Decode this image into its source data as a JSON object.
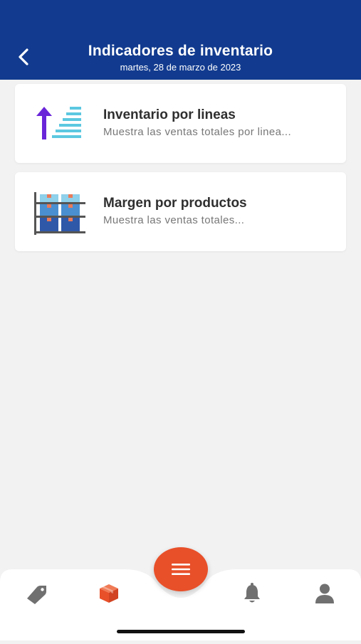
{
  "header": {
    "title": "Indicadores de inventario",
    "date": "martes, 28 de marzo de 2023",
    "background_color": "#123b8f",
    "back_icon": "chevron-left-icon"
  },
  "cards": [
    {
      "title": "Inventario por lineas",
      "description": "Muestra las ventas totales por linea...",
      "icon": "inventory-lines-icon"
    },
    {
      "title": "Margen por productos",
      "description": "Muestra las ventas totales...",
      "icon": "product-shelf-icon"
    }
  ],
  "bottom_nav": {
    "items": [
      {
        "name": "tag-icon",
        "active": false
      },
      {
        "name": "box-icon",
        "active": true
      },
      {
        "name": "bell-icon",
        "active": false
      },
      {
        "name": "user-icon",
        "active": false
      }
    ],
    "fab_icon": "menu-icon",
    "accent_color": "#e8502a",
    "inactive_color": "#707070"
  }
}
